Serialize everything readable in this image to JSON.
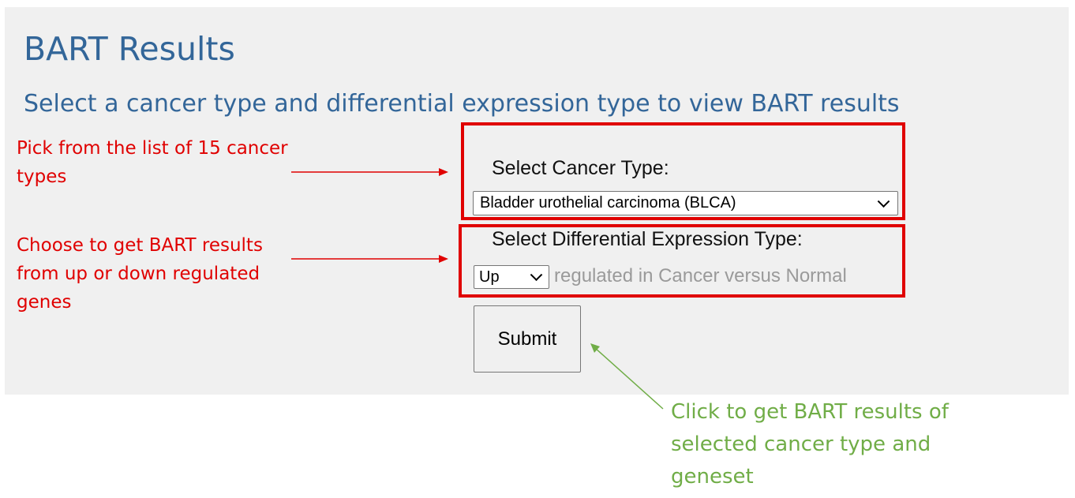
{
  "page": {
    "title": "BART Results",
    "subtitle": "Select a cancer type and differential expression type to view BART results"
  },
  "form": {
    "cancer_type": {
      "label": "Select Cancer Type:",
      "selected": "Bladder urothelial carcinoma (BLCA)"
    },
    "de_type": {
      "label": "Select Differential Expression Type:",
      "selected": "Up",
      "suffix": "regulated in Cancer versus Normal"
    },
    "submit_label": "Submit"
  },
  "annotations": {
    "cancer_type_note": "Pick from the list of 15 cancer\ntypes",
    "de_type_note": "Choose to get BART results\nfrom up or down regulated\ngenes",
    "submit_note": "Click to get BART results of\nselected cancer type and\ngeneset"
  },
  "colors": {
    "title": "#336699",
    "panel_background": "#f0f0f0",
    "highlight_box": "#e00000",
    "annotation_red": "#e00000",
    "annotation_green": "#70ad47"
  },
  "icons": {
    "dropdown": "chevron-down-icon",
    "annotation_arrow": "arrow-icon"
  }
}
